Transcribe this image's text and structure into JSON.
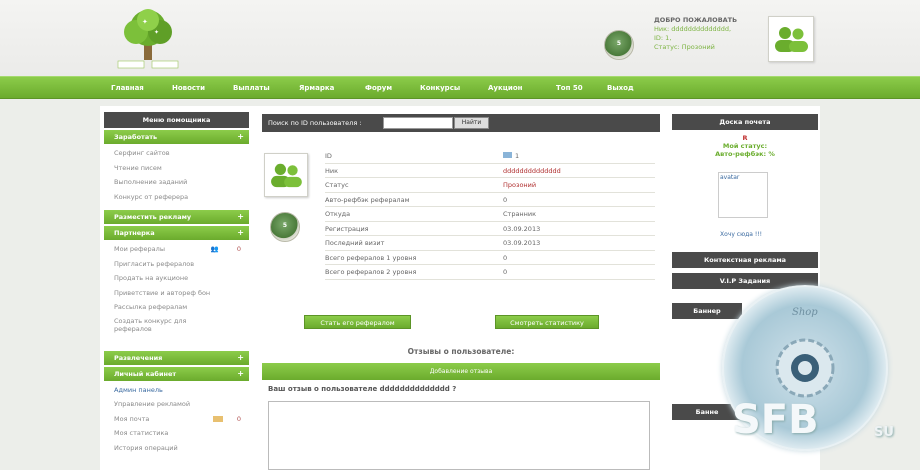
{
  "header": {
    "welcome_title": "ДОБРО ПОЖАЛОВАТЬ",
    "nick_line": "Ник: dddddddddddddd,",
    "id_line": "ID: 1,",
    "status_line": "Статус: Прозоний",
    "rating_badge": "5"
  },
  "nav": [
    "Главная",
    "Новости",
    "Выплаты",
    "Ярмарка",
    "Форум",
    "Конкурсы",
    "Аукцион",
    "Топ 50",
    "Выход"
  ],
  "sidebar": {
    "title": "Меню помощника",
    "earn": {
      "label": "Заработать",
      "items": [
        "Серфинг сайтов",
        "Чтение писем",
        "Выполнение заданий",
        "Конкурс от реферера"
      ]
    },
    "advert": {
      "label": "Разместить рекламу"
    },
    "partner": {
      "label": "Партнерка",
      "items": [
        "Мои рефералы",
        "Пригласить рефералов",
        "Продать на аукционе",
        "Приветствие и автореф бон",
        "Рассылка рефералам",
        "Создать конкурс для рефералов"
      ],
      "referrals_count": "0"
    },
    "entertainment": {
      "label": "Развлечения"
    },
    "cabinet": {
      "label": "Личный кабинет",
      "items": [
        "Админ панель",
        "Управление рекламой",
        "Моя почта",
        "Моя статистика",
        "История операций"
      ],
      "mail_count": "0"
    }
  },
  "search": {
    "label": "Поиск по ID пользователя :",
    "button": "Найти"
  },
  "profile": {
    "badge": "5",
    "rows": [
      {
        "k": "ID",
        "v": "1"
      },
      {
        "k": "Ник",
        "v": "dddddddddddddd"
      },
      {
        "k": "Статус",
        "v": "Прозоний"
      },
      {
        "k": "Авто-рефбэк рефералам",
        "v": "0"
      },
      {
        "k": "Откуда",
        "v": "Странник"
      },
      {
        "k": "Регистрация",
        "v": "03.09.2013"
      },
      {
        "k": "Последний визит",
        "v": "03.09.2013"
      },
      {
        "k": "Всего рефералов 1 уровня",
        "v": "0"
      },
      {
        "k": "Всего рефералов 2 уровня",
        "v": "0"
      }
    ],
    "btn_become": "Стать его рефералом",
    "btn_stats": "Смотреть статистику"
  },
  "reviews": {
    "title": "Отзывы о пользователе:",
    "add": "Добавление отзыва",
    "your_review": "Ваш отзыв о пользователе dddddddddddddd ?"
  },
  "right": {
    "honor_title": "Доска почета",
    "honor_status": "Мой статус:",
    "honor_refback": "Авто-рефбэк: %",
    "avatar_alt": "avatar",
    "want_here": "Хочу сюда !!!",
    "context_ads": "Контекстная реклама",
    "vip": "V.I.P Задания",
    "banner1": "Баннер",
    "banner2": "Банне"
  },
  "watermark": {
    "shop": "Shop",
    "brand": "SFB",
    "tld": "SU"
  },
  "colors": {
    "green": "#7cb342",
    "dark": "#4a4a4a",
    "red": "#b03030"
  }
}
